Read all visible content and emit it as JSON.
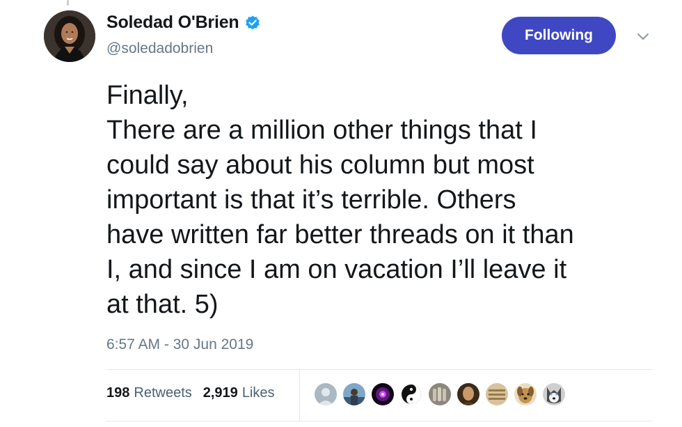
{
  "author": {
    "display_name": "Soledad O'Brien",
    "handle": "@soledadobrien",
    "verified": true,
    "avatar": "profile-photo-woman"
  },
  "follow_button": {
    "label": "Following",
    "color": "#3f48c2"
  },
  "menu_icon": "chevron-down-icon",
  "tweet": {
    "lines": [
      "Finally,",
      "There are a million other things that I",
      "could say about his column but most",
      "important is that it’s terrible. Others",
      "have written far better threads on it than",
      "I, and since I am on vacation I’ll leave it",
      "at that. 5)"
    ],
    "timestamp": "6:57 AM - 30 Jun 2019"
  },
  "stats": {
    "retweets_count": "198",
    "retweets_label": "Retweets",
    "likes_count": "2,919",
    "likes_label": "Likes"
  },
  "likers": [
    {
      "name": "default-avatar",
      "color": "#aab8c2"
    },
    {
      "name": "person-avatar",
      "color": "#4a6e8a"
    },
    {
      "name": "purple-glow-avatar",
      "color": "#2a0f3a"
    },
    {
      "name": "black-white-avatar",
      "color": "#222222"
    },
    {
      "name": "hands-avatar",
      "color": "#6f6a60"
    },
    {
      "name": "portrait-avatar",
      "color": "#6b4a2a"
    },
    {
      "name": "sign-avatar",
      "color": "#b3946a"
    },
    {
      "name": "dog-avatar",
      "color": "#a9824a"
    },
    {
      "name": "husky-avatar",
      "color": "#5a5a5a"
    }
  ]
}
